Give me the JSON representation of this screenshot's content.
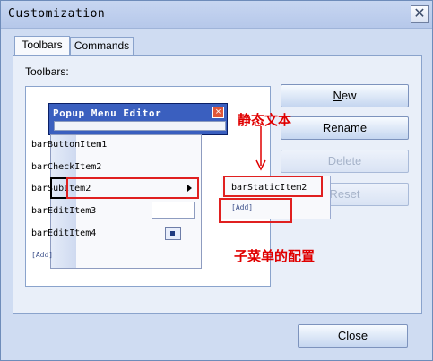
{
  "window": {
    "title": "Customization"
  },
  "tabs": [
    {
      "label": "Toolbars"
    },
    {
      "label": "Commands"
    }
  ],
  "toolbars_label": "Toolbars:",
  "buttons": {
    "new": {
      "label": "New",
      "accel": "N",
      "rest": "ew"
    },
    "rename": {
      "label_pre": "R",
      "accel": "e",
      "label_post": "name"
    },
    "delete": {
      "label": "Delete"
    },
    "reset": {
      "label": "Reset"
    },
    "close": {
      "label": "Close"
    }
  },
  "popup_editor": {
    "title": "Popup Menu Editor",
    "items": [
      {
        "label": "barButtonItem1"
      },
      {
        "label": "barCheckItem2"
      },
      {
        "label": "barSubItem2"
      },
      {
        "label": "barEditItem3"
      },
      {
        "label": "barEditItem4"
      }
    ],
    "add_label": "[Add]"
  },
  "submenu": {
    "items": [
      {
        "label": "barStaticItem2"
      }
    ],
    "add_label": "[Add]"
  },
  "annotations": {
    "static_text": "静态文本",
    "submenu_config": "子菜单的配置"
  },
  "colors": {
    "annotation": "#e00000",
    "title_bar": "#3a5fbf"
  }
}
